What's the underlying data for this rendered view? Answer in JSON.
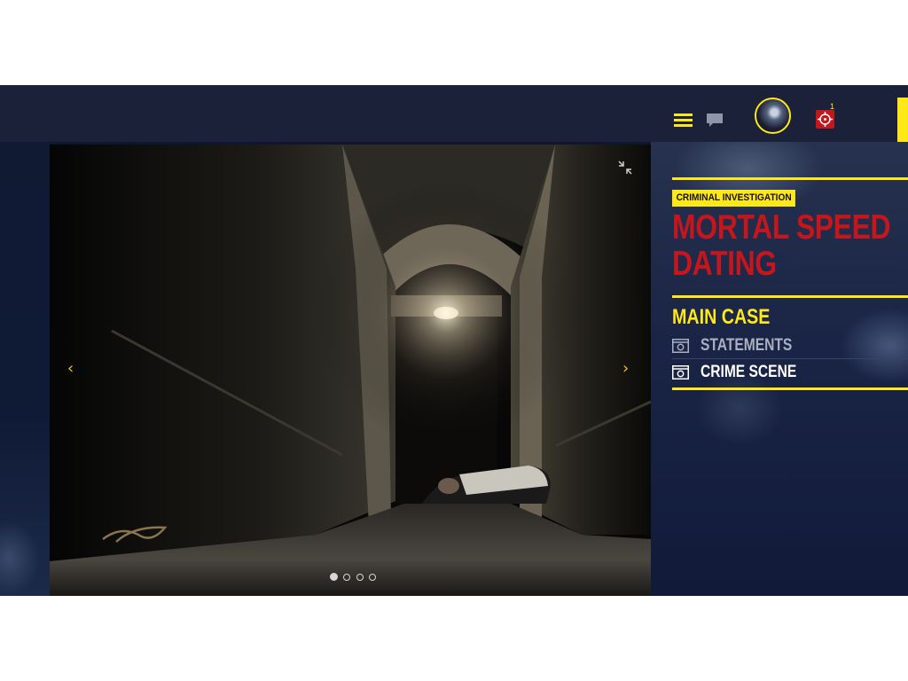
{
  "topbar": {
    "icons": [
      "menu-icon",
      "chat-icon",
      "avatar",
      "target-icon"
    ],
    "notification_count": "1"
  },
  "photo": {
    "description_icon": "crime-scene-photo",
    "slides_total": 4,
    "active_slide": 1
  },
  "case": {
    "category": "CRIMINAL INVESTIGATION",
    "title_line1": "MORTAL SPEED",
    "title_line2": "DATING",
    "section": "MAIN CASE",
    "items": [
      {
        "label": "STATEMENTS",
        "icon": "camera-icon",
        "color": "#a9b0c1"
      },
      {
        "label": "CRIME SCENE",
        "icon": "camera-icon",
        "color": "#ffffff"
      }
    ]
  },
  "colors": {
    "accent": "#ffe81a",
    "title_red": "#c4161c",
    "topbar": "#1a2138",
    "panel": "#111a38"
  }
}
